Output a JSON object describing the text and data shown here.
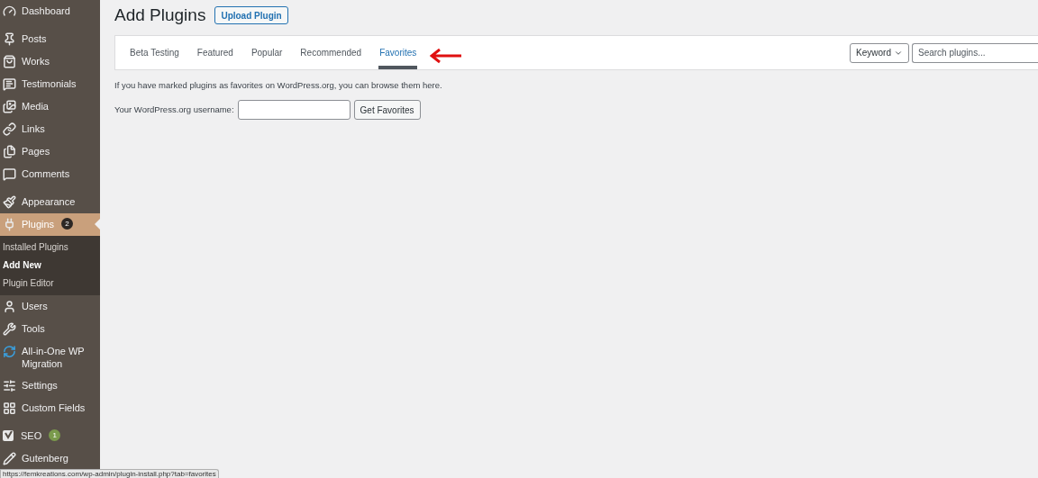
{
  "sidebar": {
    "groups": [
      {
        "items": [
          {
            "kind": "gauge",
            "label": "Dashboard",
            "selected": false
          }
        ]
      },
      {
        "items": [
          {
            "kind": "pin",
            "label": "Posts",
            "selected": false
          },
          {
            "kind": "bag",
            "label": "Works",
            "selected": false
          },
          {
            "kind": "chat",
            "label": "Testimonials",
            "selected": false
          },
          {
            "kind": "media",
            "label": "Media",
            "selected": false
          },
          {
            "kind": "link",
            "label": "Links",
            "selected": false
          },
          {
            "kind": "pages",
            "label": "Pages",
            "selected": false
          },
          {
            "kind": "comment",
            "label": "Comments",
            "selected": false
          }
        ]
      },
      {
        "items": [
          {
            "kind": "brush",
            "label": "Appearance",
            "selected": false
          },
          {
            "kind": "plug",
            "label": "Plugins",
            "selected": true,
            "badge": "2",
            "submenu": [
              {
                "label": "Installed Plugins",
                "selected": false
              },
              {
                "label": "Add New",
                "selected": true
              },
              {
                "label": "Plugin Editor",
                "selected": false
              }
            ]
          },
          {
            "kind": "user",
            "label": "Users",
            "selected": false
          },
          {
            "kind": "wrench",
            "label": "Tools",
            "selected": false
          },
          {
            "kind": "migration",
            "label": "All-in-One WP Migration",
            "selected": false
          },
          {
            "kind": "sliders",
            "label": "Settings",
            "selected": false
          },
          {
            "kind": "grid",
            "label": "Custom Fields",
            "selected": false
          }
        ]
      },
      {
        "items": [
          {
            "kind": "seo",
            "label": "SEO",
            "selected": false,
            "badge": "1"
          },
          {
            "kind": "pencil",
            "label": "Gutenberg",
            "selected": false
          }
        ]
      }
    ]
  },
  "page": {
    "title": "Add Plugins",
    "upload_button": "Upload Plugin"
  },
  "tabs": [
    {
      "label": "Beta Testing",
      "selected": false
    },
    {
      "label": "Featured",
      "selected": false
    },
    {
      "label": "Popular",
      "selected": false
    },
    {
      "label": "Recommended",
      "selected": false
    },
    {
      "label": "Favorites",
      "selected": true
    }
  ],
  "search": {
    "type_select": "Keyword",
    "placeholder": "Search plugins..."
  },
  "intro": "If you have marked plugins as favorites on WordPress.org, you can browse them here.",
  "favorites_form": {
    "label": "Your WordPress.org username:",
    "button": "Get Favorites"
  },
  "status_bar": "https://femkreations.com/wp-admin/plugin-install.php?tab=favorites"
}
